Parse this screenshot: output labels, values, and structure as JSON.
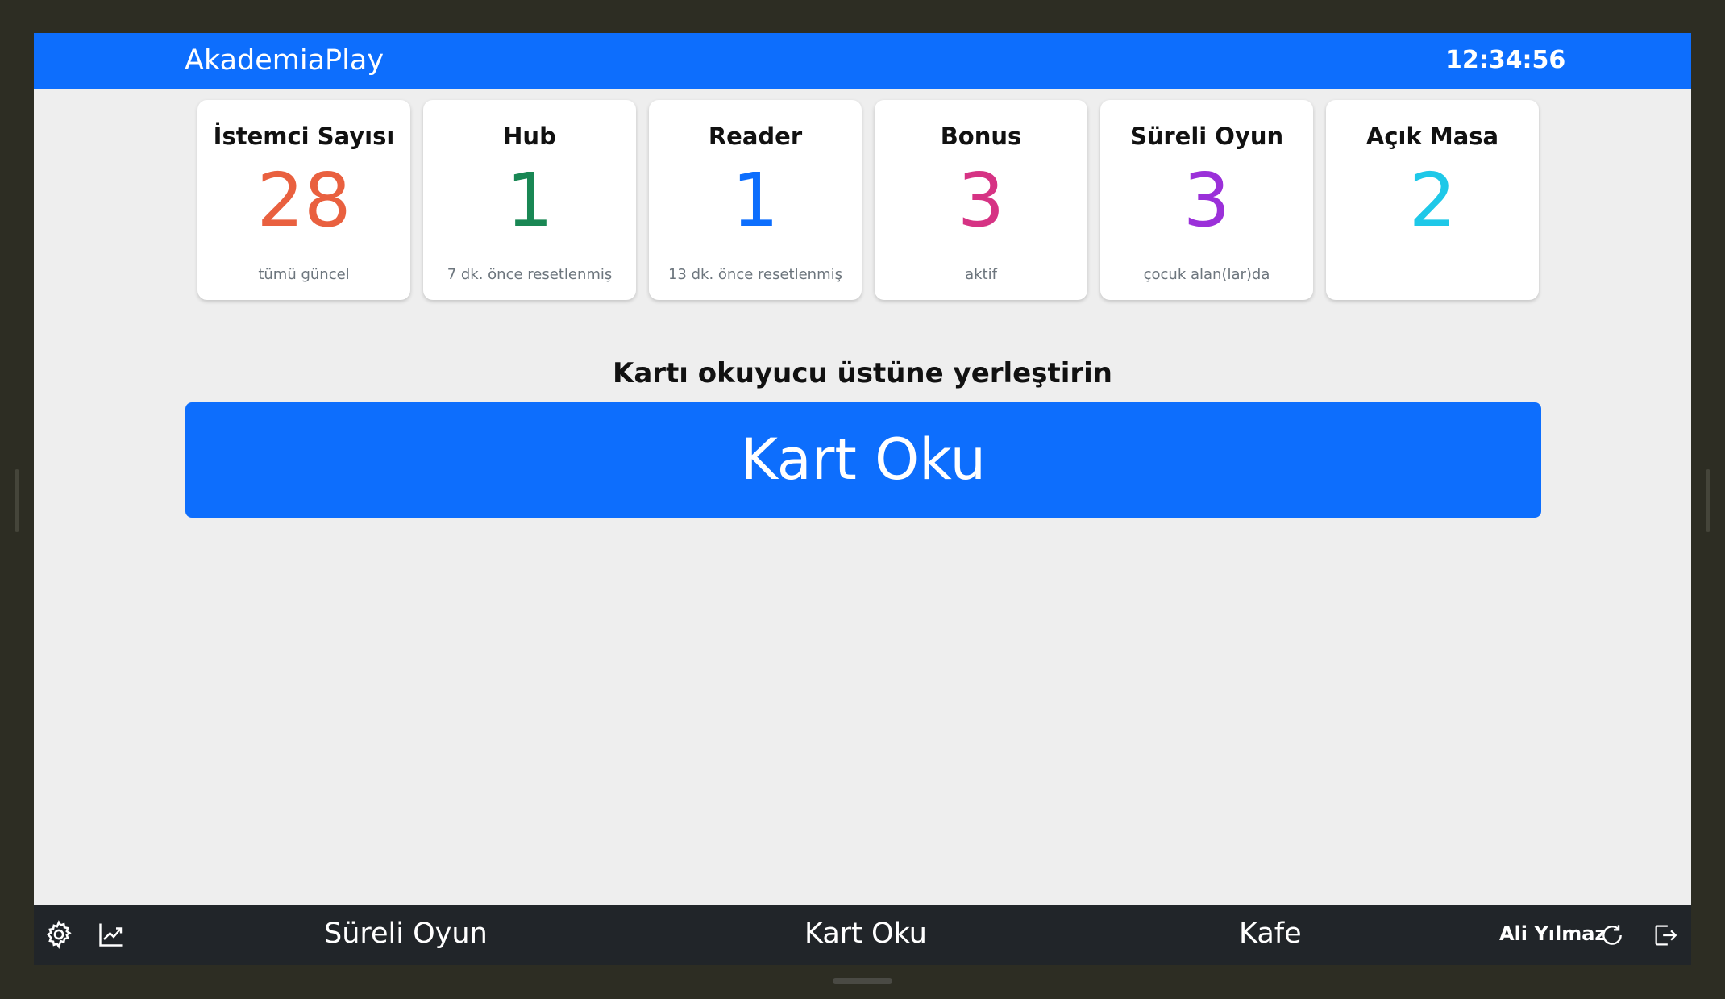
{
  "app": {
    "title": "AkademiaPlay",
    "clock": "12:34:56"
  },
  "cards": [
    {
      "title": "İstemci Sayısı",
      "value": "28",
      "sub": "tümü güncel",
      "color": "#e9603f"
    },
    {
      "title": "Hub",
      "value": "1",
      "sub": "7 dk. önce resetlenmiş",
      "color": "#198754"
    },
    {
      "title": "Reader",
      "value": "1",
      "sub": "13 dk. önce resetlenmiş",
      "color": "#0d6efd"
    },
    {
      "title": "Bonus",
      "value": "3",
      "sub": "aktif",
      "color": "#d63384"
    },
    {
      "title": "Süreli Oyun",
      "value": "3",
      "sub": "çocuk alan(lar)da",
      "color": "#9b30d9"
    },
    {
      "title": "Açık Masa",
      "value": "2",
      "sub": "",
      "color": "#1ec8e8"
    }
  ],
  "main": {
    "prompt": "Kartı okuyucu üstüne yerleştirin",
    "read_button": "Kart Oku"
  },
  "bottom_bar": {
    "nav": [
      "Süreli Oyun",
      "Kart Oku",
      "Kafe"
    ],
    "user": "Ali Yılmaz",
    "icons": [
      "gear-icon",
      "chart-line-icon",
      "refresh-icon",
      "logout-icon"
    ]
  },
  "colors": {
    "primary": "#0d6efd",
    "bottom_bar": "#212529",
    "background": "#eeeeee"
  }
}
